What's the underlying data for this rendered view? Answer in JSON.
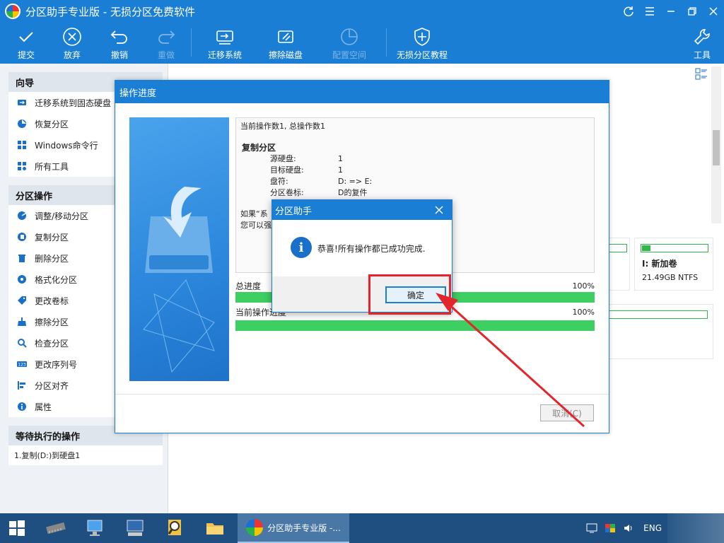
{
  "window": {
    "title": "分区助手专业版 - 无损分区免费软件"
  },
  "toolbar": {
    "items": [
      {
        "label": "提交",
        "icon": "check-icon",
        "enabled": true
      },
      {
        "label": "放弃",
        "icon": "cancel-circle-icon",
        "enabled": true
      },
      {
        "label": "撤销",
        "icon": "undo-icon",
        "enabled": true
      },
      {
        "label": "重做",
        "icon": "redo-icon",
        "enabled": false
      },
      {
        "label": "迁移系统",
        "icon": "migrate-os-icon",
        "enabled": true
      },
      {
        "label": "擦除磁盘",
        "icon": "wipe-disk-icon",
        "enabled": true
      },
      {
        "label": "配置空间",
        "icon": "allocate-space-icon",
        "enabled": false
      },
      {
        "label": "无损分区教程",
        "icon": "shield-icon",
        "enabled": true
      },
      {
        "label": "工具",
        "icon": "tools-icon",
        "enabled": true
      }
    ]
  },
  "sidebar": {
    "wizard": {
      "title": "向导",
      "items": [
        {
          "label": "迁移系统到固态硬盘",
          "icon": "migrate-ssd-icon"
        },
        {
          "label": "恢复分区",
          "icon": "recover-partition-icon"
        },
        {
          "label": "Windows命令行",
          "icon": "windows-icon"
        },
        {
          "label": "所有工具",
          "icon": "all-tools-icon"
        }
      ]
    },
    "operations": {
      "title": "分区操作",
      "items": [
        {
          "label": "调整/移动分区",
          "icon": "resize-partition-icon"
        },
        {
          "label": "复制分区",
          "icon": "copy-partition-icon"
        },
        {
          "label": "删除分区",
          "icon": "delete-partition-icon"
        },
        {
          "label": "格式化分区",
          "icon": "format-partition-icon"
        },
        {
          "label": "更改卷标",
          "icon": "label-tag-icon"
        },
        {
          "label": "擦除分区",
          "icon": "wipe-partition-icon"
        },
        {
          "label": "检查分区",
          "icon": "check-partition-icon"
        },
        {
          "label": "更改序列号",
          "icon": "serial-number-icon"
        },
        {
          "label": "分区对齐",
          "icon": "align-partition-icon"
        },
        {
          "label": "属性",
          "icon": "info-icon"
        }
      ]
    },
    "pending": {
      "title": "等待执行的操作",
      "items": [
        "1.复制(D:)到硬盘1"
      ]
    }
  },
  "main": {
    "disk_card": {
      "name": "I: 新加卷",
      "size": "21.49GB NTFS"
    }
  },
  "progress_dialog": {
    "title": "操作进度",
    "log_header": "当前操作数1, 总操作数1",
    "op_title": "复制分区",
    "details": [
      {
        "key": "源硬盘:",
        "value": "1"
      },
      {
        "key": "目标硬盘:",
        "value": "1"
      },
      {
        "key": "盘符:",
        "value": "D: => E:"
      },
      {
        "key": "分区卷标:",
        "value": "D的复件"
      }
    ],
    "note_line1": "如果“系",
    "note_line2": "您可以强",
    "total_label": "总进度",
    "total_pct": "100%",
    "total_progress": 1.0,
    "current_label": "当前操作进度",
    "current_pct": "100%",
    "current_progress": 1.0,
    "cancel_label": "取消(C)"
  },
  "message_box": {
    "title": "分区助手",
    "message": "恭喜!所有操作都已成功完成.",
    "ok_label": "确定",
    "icon": "info-icon"
  },
  "taskbar": {
    "active_app_label": "分区助手专业版 -...",
    "language": "ENG"
  },
  "colors": {
    "title_blue": "#1a7fd4",
    "progress_green": "#3ecf62",
    "annotation_red": "#e3262c"
  }
}
